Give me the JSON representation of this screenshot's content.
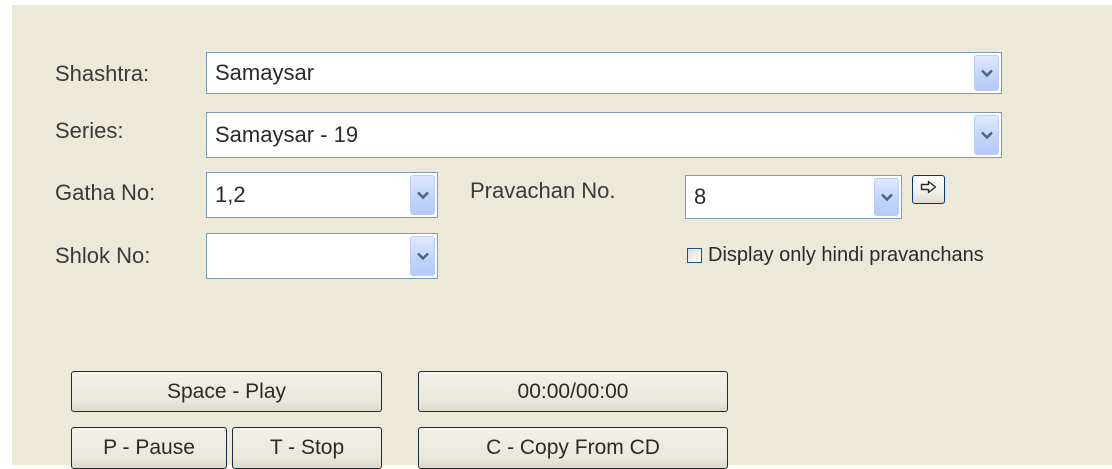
{
  "fields": {
    "shashtra": {
      "label": "Shashtra:",
      "value": "Samaysar"
    },
    "series": {
      "label": "Series:",
      "value": "Samaysar - 19"
    },
    "gatha": {
      "label": "Gatha No:",
      "value": "1,2"
    },
    "pravachan": {
      "label": "Pravachan No.",
      "value": "8"
    },
    "shlok": {
      "label": "Shlok No:",
      "value": ""
    }
  },
  "go_button": {
    "icon": "right-arrow-icon"
  },
  "hindi_only": {
    "label": "Display only hindi pravanchans",
    "checked": false
  },
  "controls": {
    "play": "Space - Play",
    "time": "00:00/00:00",
    "pause": "P - Pause",
    "stop": "T - Stop",
    "copy": "C - Copy From CD"
  },
  "colors": {
    "panel_bg": "#ece9d8",
    "field_border": "#7f9db9",
    "dropdown_button": "#c1d5fb",
    "dropdown_arrow": "#4d6185"
  }
}
